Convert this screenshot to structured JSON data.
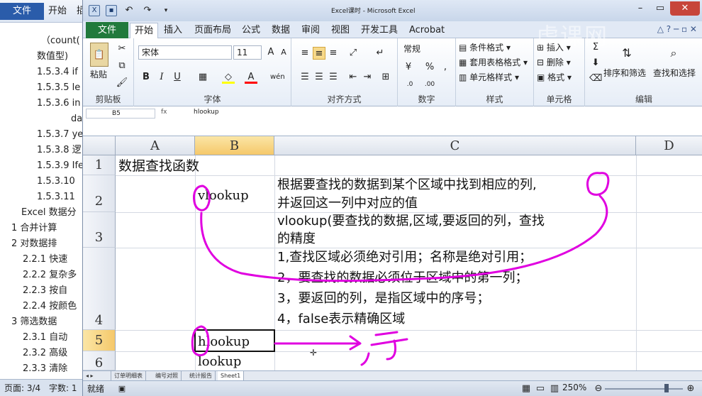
{
  "word": {
    "file_tab": "文件",
    "home_tab": "开始",
    "more_tab": "插",
    "nav_items": [
      "（count(",
      "数值型)",
      "1.5.3.4 if",
      "1.5.3.5 le",
      "1.5.3.6 in",
      "da",
      "1.5.3.7 ye",
      "1.5.3.8 逻",
      "1.5.3.9 Ife",
      "1.5.3.10",
      "1.5.3.11",
      "Excel 数据分",
      "1    合并计算",
      "2    对数据排",
      "2.2.1 快速",
      "2.2.2 复杂多",
      "2.2.3 按自",
      "2.2.4 按颜色",
      "3    筛选数据",
      "2.3.1 自动",
      "2.3.2 高级",
      "2.3.3 清除"
    ],
    "status_page": "页面: 3/4",
    "status_words": "字数: 1"
  },
  "excel": {
    "title": "Excel课时 - Microsoft Excel",
    "file_tab": "文件",
    "tabs": [
      "开始",
      "插入",
      "页面布局",
      "公式",
      "数据",
      "审阅",
      "视图",
      "开发工具",
      "Acrobat"
    ],
    "ribbon": {
      "paste": "粘贴",
      "clipboard": "剪贴板",
      "font_name": "宋体",
      "font_size": "11",
      "font_group": "字体",
      "align_group": "对齐方式",
      "number_format": "常规",
      "number_group": "数字",
      "cond_format": "条件格式",
      "table_format": "套用表格格式",
      "cell_style": "单元格样式",
      "style_group": "样式",
      "insert": "插入",
      "delete": "删除",
      "format": "格式",
      "cells_group": "单元格",
      "sort_filter": "排序和筛选",
      "find_select": "查找和选择",
      "edit_group": "编辑",
      "bold": "B",
      "italic": "I",
      "underline": "U"
    },
    "namebox": "B5",
    "formula": "hlookup",
    "columns": [
      "A",
      "B",
      "C",
      "D"
    ],
    "rows": [
      "1",
      "2",
      "3",
      "4",
      "5",
      "6"
    ],
    "cells": {
      "a1": "数据查找函数",
      "b2": "vlookup",
      "c2_line1": "根据要查找的数据到某个区域中找到相应的列,",
      "c2_line2": "并返回这一列中对应的值",
      "c3_line1": "vlookup(要查找的数据,区域,要返回的列，查找",
      "c3_line2": "的精度",
      "c4_line1": "1,查找区域必须绝对引用；名称是绝对引用；",
      "c4_line2": "2，要查找的数据必须位于区域中的第一列；",
      "c4_line3": "3，要返回的列，是指区域中的序号；",
      "c4_line4": "4，false表示精确区域",
      "b5": "hlookup",
      "b6": "lookup"
    },
    "sheet_tabs": [
      "订单明细表",
      "编号对照",
      "统计报告",
      "Sheet1"
    ],
    "status_ready": "就绪",
    "zoom": "250%"
  },
  "ink_color": "#e000e0",
  "watermark": "虎课网"
}
